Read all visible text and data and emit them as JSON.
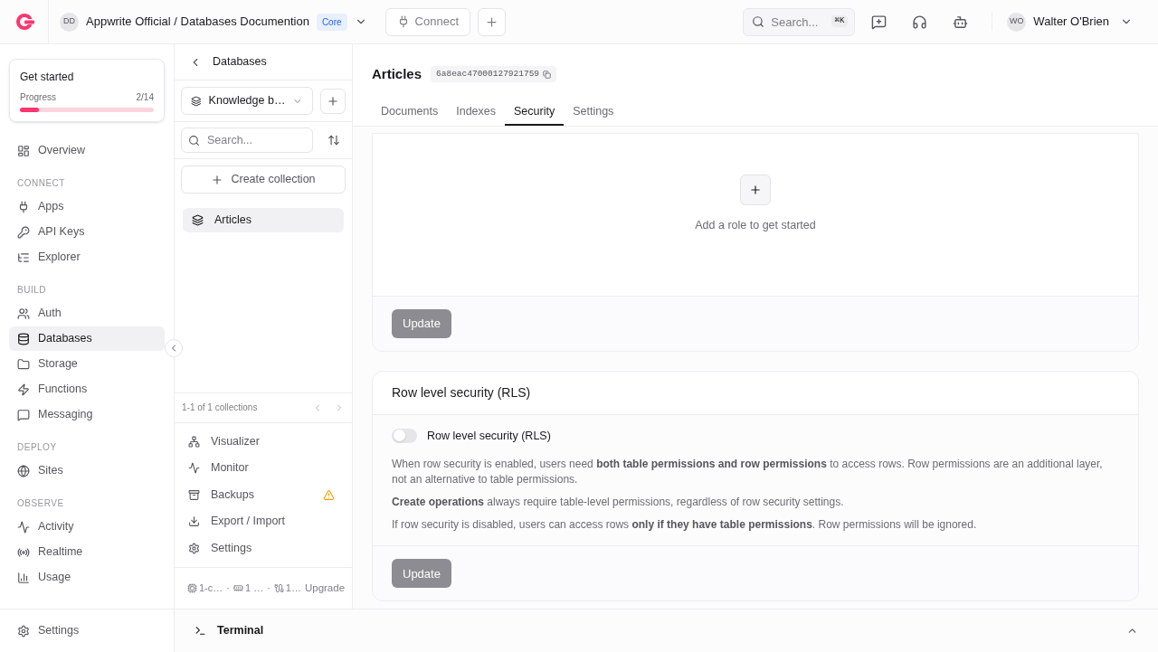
{
  "topbar": {
    "org_initials": "DD",
    "project": "Appwrite Official / Databases Documention",
    "plan_badge": "Core",
    "connect": "Connect",
    "search": {
      "placeholder": "Search..."
    },
    "shortcut": "⌘K",
    "user": {
      "initials": "WO",
      "name": "Walter O'Brien"
    }
  },
  "get_started": {
    "title": "Get started",
    "label": "Progress",
    "count": "2/14",
    "level": 0.14
  },
  "sidebar": {
    "sections": [
      {
        "items": [
          {
            "label": "Overview",
            "selected": false
          }
        ]
      },
      {
        "heading": "CONNECT",
        "items": [
          {
            "label": "Apps",
            "selected": false
          },
          {
            "label": "API Keys",
            "selected": false
          },
          {
            "label": "Explorer",
            "selected": false
          }
        ]
      },
      {
        "heading": "BUILD",
        "items": [
          {
            "label": "Auth",
            "selected": false
          },
          {
            "label": "Databases",
            "selected": true
          },
          {
            "label": "Storage",
            "selected": false
          },
          {
            "label": "Functions",
            "selected": false
          },
          {
            "label": "Messaging",
            "selected": false
          }
        ]
      },
      {
        "heading": "DEPLOY",
        "items": [
          {
            "label": "Sites",
            "selected": false
          }
        ]
      },
      {
        "heading": "OBSERVE",
        "items": [
          {
            "label": "Activity",
            "selected": false
          },
          {
            "label": "Realtime",
            "selected": false
          },
          {
            "label": "Usage",
            "selected": false
          }
        ]
      }
    ],
    "settings": "Settings"
  },
  "databases_panel": {
    "title": "Databases",
    "database_select": "Knowledge b…",
    "search": {
      "placeholder": "Search..."
    },
    "create": "Create collection",
    "collections": [
      {
        "label": "Articles",
        "selected": true
      }
    ],
    "pagination": "1-1 of 1 collections",
    "menu": [
      {
        "label": "Visualizer",
        "warning": false
      },
      {
        "label": "Monitor",
        "warning": false
      },
      {
        "label": "Backups",
        "warning": true
      },
      {
        "label": "Export / Import",
        "warning": false
      },
      {
        "label": "Settings",
        "warning": false
      }
    ],
    "usage": [
      "1-c…",
      "1 …",
      "1…"
    ],
    "usage_separator": "·",
    "upgrade": "Upgrade"
  },
  "collection": {
    "title": "Articles",
    "id": "6a8eac47000127921759",
    "tabs": [
      {
        "label": "Documents",
        "selected": false
      },
      {
        "label": "Indexes",
        "selected": false
      },
      {
        "label": "Security",
        "selected": true
      },
      {
        "label": "Settings",
        "selected": false
      }
    ],
    "permissions": {
      "empty_text": "Add a role to get started",
      "button": {
        "label": "Update",
        "disabled": true
      }
    },
    "rls": {
      "title": "Row level security (RLS)",
      "toggle_label": "Row level security (RLS)",
      "on": false,
      "paragraphs": [
        "When row security is enabled, users need **both table permissions and row permissions** to access rows. Row permissions are an additional layer, not an alternative to table permissions.",
        "**Create operations** always require table-level permissions, regardless of row security settings.",
        "If row security is disabled, users can access rows **only if they have table permissions**. Row permissions will be ignored."
      ],
      "button": {
        "label": "Update",
        "disabled": true
      }
    }
  },
  "terminal": {
    "label": "Terminal",
    "expanded": false
  }
}
